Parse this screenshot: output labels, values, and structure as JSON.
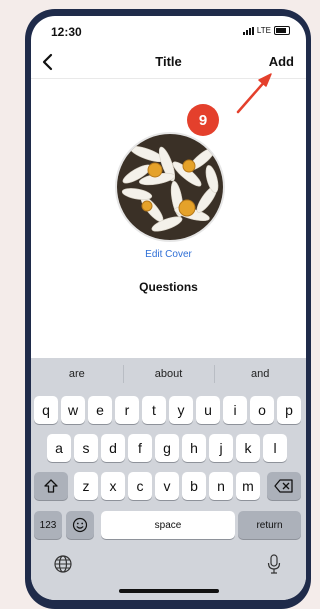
{
  "status": {
    "time": "12:30",
    "network": "LTE"
  },
  "nav": {
    "title": "Title",
    "add": "Add"
  },
  "edit_cover": "Edit Cover",
  "section_title": "Questions",
  "badge": "9",
  "suggestions": [
    "are",
    "about",
    "and"
  ],
  "keys": {
    "row1": [
      "q",
      "w",
      "e",
      "r",
      "t",
      "y",
      "u",
      "i",
      "o",
      "p"
    ],
    "row2": [
      "a",
      "s",
      "d",
      "f",
      "g",
      "h",
      "j",
      "k",
      "l"
    ],
    "row3": [
      "z",
      "x",
      "c",
      "v",
      "b",
      "n",
      "m"
    ],
    "numbers": "123",
    "space": "space",
    "return": "return"
  },
  "colors": {
    "accent_link": "#2f6fd6",
    "badge": "#e4402c",
    "phone_frame": "#1f2b4a"
  }
}
